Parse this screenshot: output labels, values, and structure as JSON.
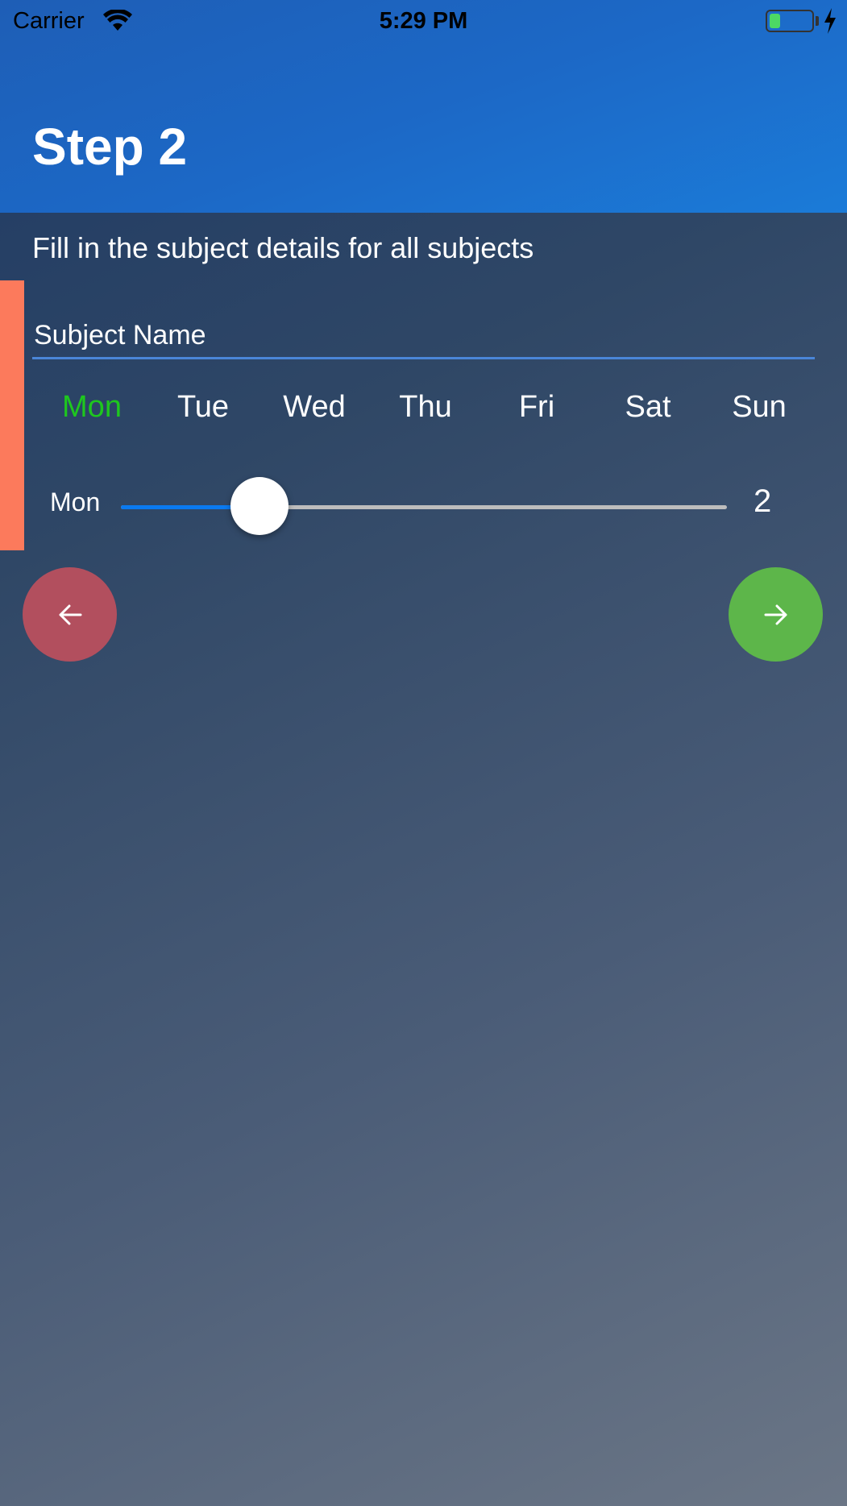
{
  "status_bar": {
    "carrier": "Carrier",
    "time": "5:29 PM",
    "battery_level": 0.25,
    "battery_color": "#4cd964"
  },
  "header": {
    "title": "Step 2",
    "color": "#1c68c6"
  },
  "subtitle": "Fill in the subject details for all subjects",
  "form": {
    "subject_name_value": "",
    "subject_name_placeholder": "Subject Name",
    "days": [
      {
        "label": "Mon",
        "selected": true
      },
      {
        "label": "Tue",
        "selected": false
      },
      {
        "label": "Wed",
        "selected": false
      },
      {
        "label": "Thu",
        "selected": false
      },
      {
        "label": "Fri",
        "selected": false
      },
      {
        "label": "Sat",
        "selected": false
      },
      {
        "label": "Sun",
        "selected": false
      }
    ],
    "selected_day_color": "#1ec71e",
    "slider": {
      "label": "Mon",
      "value": "2",
      "fraction": 0.229
    }
  },
  "buttons": {
    "prev_icon": "arrow-left-icon",
    "next_icon": "arrow-right-icon",
    "prev_color": "#b24f5e",
    "next_color": "#5db64a"
  },
  "accent_color": "#fc7a5c"
}
